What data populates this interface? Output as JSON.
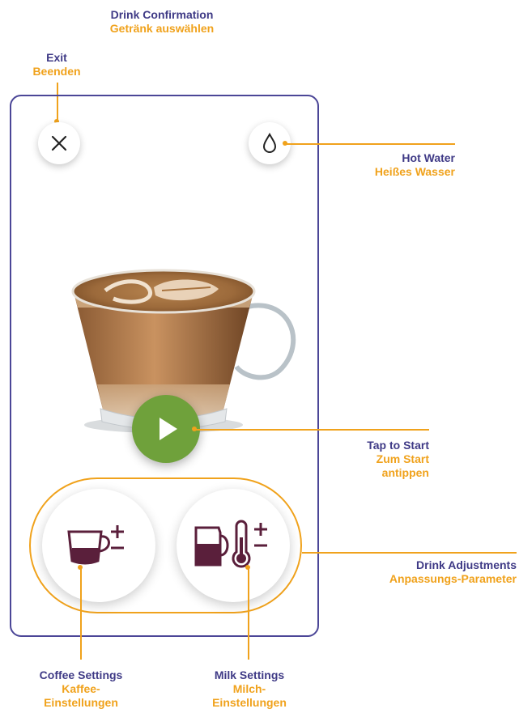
{
  "header": {
    "title_en": "Drink Confirmation",
    "title_de": "Getränk auswählen"
  },
  "callouts": {
    "exit": {
      "en": "Exit",
      "de": "Beenden"
    },
    "hot_water": {
      "en": "Hot Water",
      "de": "Heißes Wasser"
    },
    "tap_to_start": {
      "en": "Tap to Start",
      "de_line1": "Zum Start",
      "de_line2": "antippen"
    },
    "drink_adjustments": {
      "en": "Drink Adjustments",
      "de": "Anpassungs-Parameter"
    },
    "coffee_settings": {
      "en": "Coffee Settings",
      "de_line1": "Kaffee-",
      "de_line2": "Einstellungen"
    },
    "milk_settings": {
      "en": "Milk Settings",
      "de_line1": "Milch-",
      "de_line2": "Einstellungen"
    }
  },
  "icons": {
    "exit": "close-icon",
    "hot_water": "water-drop-icon",
    "start": "play-icon",
    "coffee": "coffee-cup-plus-minus-icon",
    "milk": "milk-jug-thermometer-plus-minus-icon"
  },
  "colors": {
    "frame": "#4b4697",
    "label_en": "#3f3a86",
    "label_de": "#f0a21c",
    "start_button": "#6fa13b",
    "icon": "#5a1f3b"
  }
}
